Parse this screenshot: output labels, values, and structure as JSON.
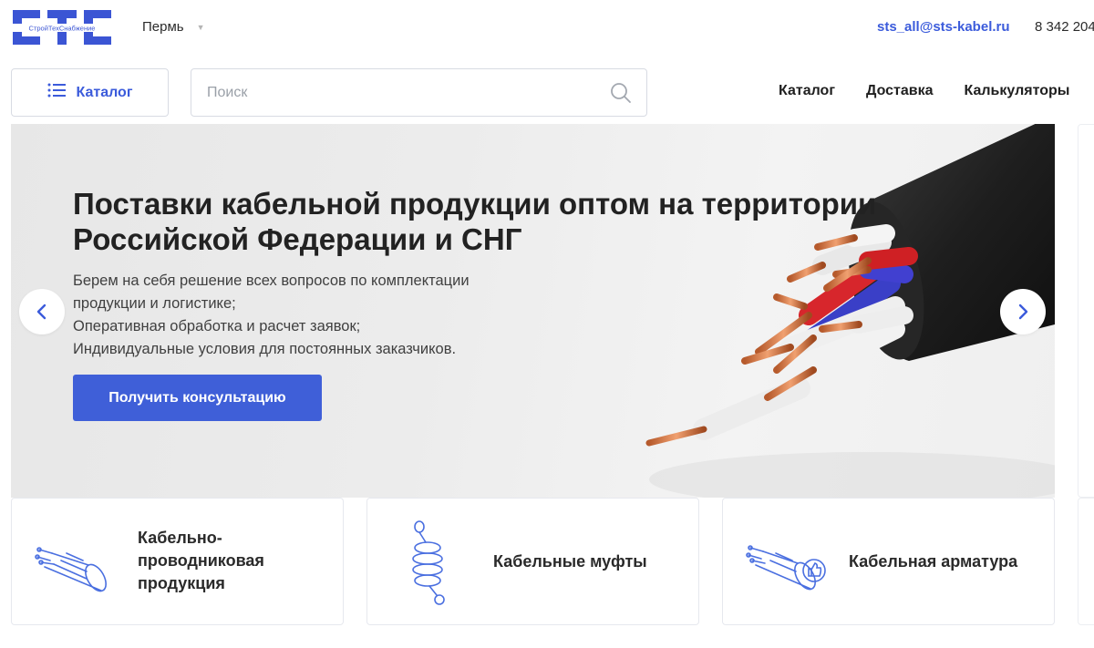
{
  "header": {
    "logo_text": "СТС",
    "logo_subtext": "СтройТехСнабжение",
    "city": "Пермь",
    "email": "sts_all@sts-kabel.ru",
    "phone": "8 342 204"
  },
  "nav": {
    "catalog_button": "Каталог",
    "search_placeholder": "Поиск",
    "links": [
      "Каталог",
      "Доставка",
      "Калькуляторы"
    ]
  },
  "hero": {
    "title": "Поставки кабельной продукции оптом на территории Российской Федерации и СНГ",
    "text_lines": [
      "Берем на себя решение всех вопросов по комплектации",
      "продукции и логистике;",
      "Оперативная обработка и расчет заявок;",
      "Индивидуальные условия для постоянных заказчиков."
    ],
    "cta": "Получить консультацию"
  },
  "categories": [
    {
      "name": "Кабельно-проводниковая продукция",
      "lines": [
        "Кабельно-",
        "проводниковая",
        "продукция"
      ],
      "icon": "cable-icon"
    },
    {
      "name": "Кабельные муфты",
      "icon": "cable-coupling-icon"
    },
    {
      "name": "Кабельная арматура",
      "icon": "cable-fitting-icon"
    }
  ],
  "colors": {
    "accent": "#3b5bdb",
    "button": "#3f5fd8",
    "icon_stroke": "#4a6fe0"
  }
}
